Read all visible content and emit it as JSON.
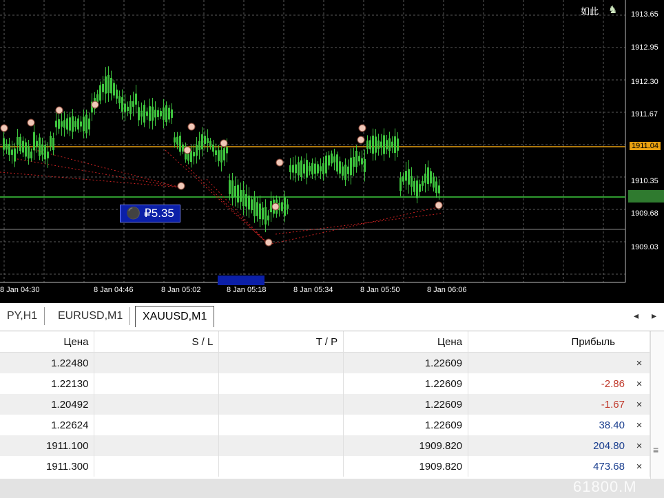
{
  "chart": {
    "top_right_text": "如此",
    "top_right_icon": "user-icon",
    "price_labels": [
      "1913.65",
      "1912.95",
      "1912.30",
      "1911.67",
      "1911.04",
      "1910.35",
      "1909.68",
      "1909.03"
    ],
    "current_price": "1911.04",
    "time_labels": [
      "8 Jan 04:30",
      "8 Jan 04:46",
      "8 Jan 05:02",
      "8 Jan 05:18",
      "8 Jan 05:34",
      "8 Jan 05:50",
      "8 Jan 06:06"
    ],
    "order_label": "⚫ ₽5.35",
    "colors": {
      "background": "#000000",
      "grid": "#5a5a5a",
      "candle": "#3ec43e",
      "current_line": "#e8a010",
      "green_line": "#2f9a2f",
      "trade_line": "#cc2222"
    }
  },
  "tabs": {
    "items": [
      "PY,H1",
      "EURUSD,M1",
      "XAUUSD,M1"
    ],
    "active": "XAUUSD,M1",
    "nav_left": "◂",
    "nav_right": "▸"
  },
  "table": {
    "headers": [
      "Цена",
      "S / L",
      "T / P",
      "Цена",
      "Прибыль"
    ],
    "rows": [
      {
        "open_price": "1.22480",
        "sl": "",
        "tp": "",
        "price": "1.22609",
        "profit": ""
      },
      {
        "open_price": "1.22130",
        "sl": "",
        "tp": "",
        "price": "1.22609",
        "profit": "-2.86"
      },
      {
        "open_price": "1.20492",
        "sl": "",
        "tp": "",
        "price": "1.22609",
        "profit": "-1.67"
      },
      {
        "open_price": "1.22624",
        "sl": "",
        "tp": "",
        "price": "1.22609",
        "profit": "38.40"
      },
      {
        "open_price": "1911.100",
        "sl": "",
        "tp": "",
        "price": "1909.820",
        "profit": "204.80"
      },
      {
        "open_price": "1911.300",
        "sl": "",
        "tp": "",
        "price": "1909.820",
        "profit": "473.68"
      }
    ],
    "close_symbol": "×"
  },
  "watermark": "61800.M"
}
